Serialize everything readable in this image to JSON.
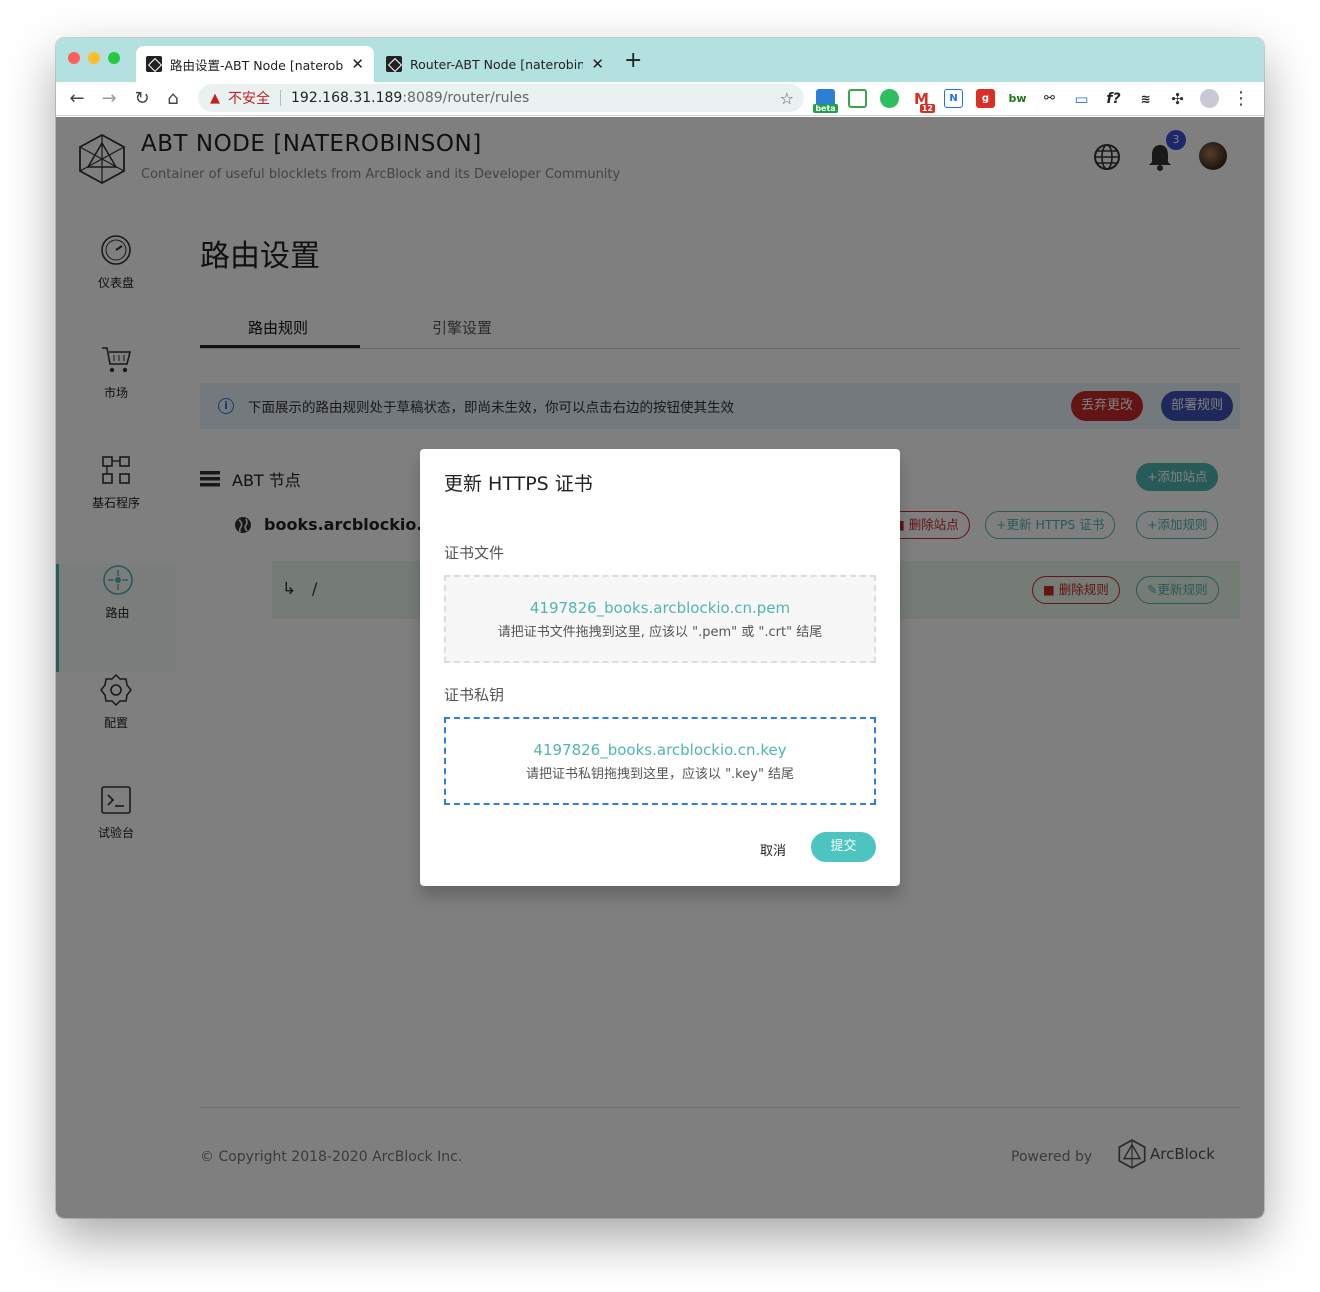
{
  "browser": {
    "tabs": [
      {
        "title": "路由设置-ABT Node [naterobinson]"
      },
      {
        "title": "Router-ABT Node [naterobinson]"
      }
    ],
    "new_tab": "+",
    "address": {
      "insecure_label": "不安全",
      "host": "192.168.31.189",
      "path": ":8089/router/rules"
    },
    "extensions": {
      "beta_label": "beta",
      "mail_count": "12"
    }
  },
  "header": {
    "title": "ABT NODE [NATEROBINSON]",
    "subtitle": "Container of useful blocklets from ArcBlock and its Developer Community",
    "notification_count": "3"
  },
  "sidebar": {
    "items": [
      {
        "label": "仪表盘",
        "icon": "dashboard-icon"
      },
      {
        "label": "市场",
        "icon": "cart-icon"
      },
      {
        "label": "基石程序",
        "icon": "blocklets-icon"
      },
      {
        "label": "路由",
        "icon": "router-icon",
        "active": true
      },
      {
        "label": "配置",
        "icon": "gear-icon"
      },
      {
        "label": "试验台",
        "icon": "terminal-icon"
      }
    ]
  },
  "main": {
    "title": "路由设置",
    "tabs": [
      {
        "label": "路由规则"
      },
      {
        "label": "引擎设置"
      }
    ],
    "alert": {
      "text": "下面展示的路由规则处于草稿状态，即尚未生效，你可以点击右边的按钮使其生效",
      "discard_label": "丢弃更改",
      "deploy_label": "部署规则"
    },
    "node_label": "ABT 节点",
    "add_site_label": "+添加站点",
    "site": {
      "domain": "books.arcblockio.cn",
      "delete_site_label": "删除站点",
      "update_cert_label": "+更新 HTTPS 证书",
      "add_rule_label": "+添加规则"
    },
    "rule": {
      "path": "/",
      "delete_rule_label": "删除规则",
      "update_rule_label": "更新规则"
    }
  },
  "footer": {
    "copyright": "© Copyright 2018-2020  ArcBlock Inc.",
    "powered_by": "Powered by",
    "brand": "ArcBlock"
  },
  "dialog": {
    "title": "更新 HTTPS 证书",
    "cert_label": "证书文件",
    "cert_file": "4197826_books.arcblockio.cn.pem",
    "cert_hint": "请把证书文件拖拽到这里, 应该以 \".pem\" 或 \".crt\" 结尾",
    "key_label": "证书私钥",
    "key_file": "4197826_books.arcblockio.cn.key",
    "key_hint": "请把证书私钥拖拽到这里，应该以 \".key\" 结尾",
    "cancel_label": "取消",
    "submit_label": "提交"
  }
}
